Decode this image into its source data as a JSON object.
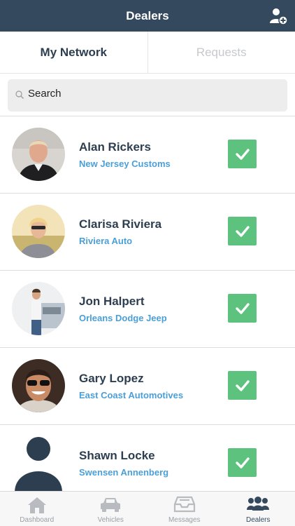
{
  "header": {
    "title": "Dealers",
    "add_icon": "add-user-icon"
  },
  "tabs": [
    {
      "label": "My Network",
      "active": true
    },
    {
      "label": "Requests",
      "active": false
    }
  ],
  "search": {
    "placeholder": "Search"
  },
  "dealers": [
    {
      "name": "Alan Rickers",
      "company": "New Jersey Customs",
      "checked": true
    },
    {
      "name": "Clarisa Riviera",
      "company": "Riviera Auto",
      "checked": true
    },
    {
      "name": "Jon Halpert",
      "company": "Orleans Dodge Jeep",
      "checked": true
    },
    {
      "name": "Gary Lopez",
      "company": "East Coast Automotives",
      "checked": true
    },
    {
      "name": "Shawn Locke",
      "company": "Swensen Annenberg",
      "checked": true
    }
  ],
  "bottom_nav": [
    {
      "label": "Dashboard",
      "icon": "home-icon",
      "active": false
    },
    {
      "label": "Vehicles",
      "icon": "car-icon",
      "active": false
    },
    {
      "label": "Messages",
      "icon": "inbox-icon",
      "active": false
    },
    {
      "label": "Dealers",
      "icon": "people-icon",
      "active": true
    }
  ],
  "colors": {
    "header": "#34495e",
    "accent_link": "#4a9fd8",
    "check": "#5cc27e",
    "name_text": "#2c3e50"
  }
}
